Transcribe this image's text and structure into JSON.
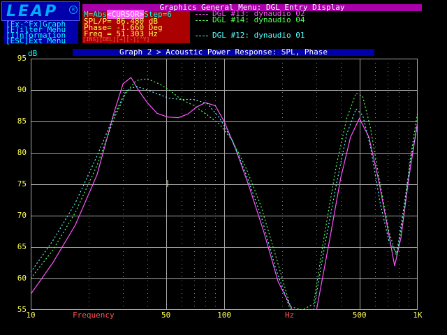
{
  "logo": {
    "text": "LEAP",
    "reg": "R"
  },
  "menu": {
    "title": "Graphics General Menu: DGL Entry Display"
  },
  "keys": [
    "[Fx-^Fx]Graph",
    "[F]ilter Menu",
    "[I]nformation",
    "[ESC]Ext Menu"
  ],
  "readout": {
    "mode": "M=Abs",
    "cursor": "<CURSOR>",
    "step": "Step=6",
    "spl": "SPL/P=   86.480 dB",
    "phase": "Phase=   -1.660 Deg",
    "freq": "Freq =   51.303 Hz",
    "kbd": "[INS][DEL][+][-][^Y]"
  },
  "legend": [
    {
      "label": "DGL #13: dynaudio 02",
      "color": "#ff55ff"
    },
    {
      "label": "DGL #14: dynaudio 04",
      "color": "#55ff55"
    },
    {
      "label": "DGL #12: dynaudio 01",
      "color": "#55ffff"
    }
  ],
  "graph": {
    "title": "Graph 2 > Acoustic Power Response: SPL, Phase",
    "y_unit": "dB",
    "x_axis_label": "Frequency",
    "x_unit_label": "Hz"
  },
  "chart_data": {
    "type": "line",
    "xscale": "log",
    "xlim": [
      10,
      1000
    ],
    "ylim": [
      55,
      95
    ],
    "y_ticks": [
      95,
      90,
      85,
      80,
      75,
      70,
      65,
      60,
      55
    ],
    "x_tick_labels": [
      {
        "value": 10,
        "label": "10"
      },
      {
        "value": 50,
        "label": "50"
      },
      {
        "value": 100,
        "label": "100"
      },
      {
        "value": 500,
        "label": "500"
      },
      {
        "value": 1000,
        "label": "1K"
      }
    ],
    "series": [
      {
        "color": "#ff55ff",
        "dash": "none",
        "x": [
          10,
          13,
          17,
          22,
          27,
          30,
          33,
          36,
          40,
          45,
          51,
          58,
          65,
          72,
          80,
          90,
          100,
          115,
          135,
          160,
          190,
          225,
          260,
          300,
          350,
          400,
          450,
          500,
          560,
          630,
          700,
          760,
          820,
          900,
          1000
        ],
        "y": [
          57.5,
          62.5,
          68.5,
          76.5,
          86.5,
          91.0,
          92.0,
          90.0,
          88.0,
          86.3,
          85.7,
          85.6,
          86.2,
          87.3,
          88.0,
          87.5,
          85.0,
          80.5,
          74.5,
          67.5,
          59.5,
          51.0,
          48.0,
          54.0,
          66.0,
          76.0,
          82.5,
          85.5,
          82.5,
          75.5,
          68.0,
          62.0,
          66.5,
          76.0,
          85.0
        ]
      },
      {
        "color": "#55ff55",
        "dash": "2,3",
        "x": [
          10,
          13,
          17,
          22,
          27,
          31,
          35,
          40,
          46,
          52,
          60,
          70,
          82,
          95,
          110,
          130,
          155,
          185,
          220,
          255,
          290,
          330,
          380,
          430,
          480,
          520,
          570,
          640,
          710,
          780,
          850,
          920,
          1000
        ],
        "y": [
          60.0,
          64.5,
          70.5,
          78.0,
          85.5,
          89.5,
          91.5,
          91.8,
          91.0,
          90.0,
          88.5,
          87.5,
          86.0,
          84.5,
          82.0,
          77.5,
          71.5,
          63.5,
          55.5,
          50.5,
          56.0,
          67.0,
          78.0,
          85.5,
          89.5,
          89.0,
          84.0,
          75.0,
          67.5,
          63.5,
          70.5,
          79.5,
          86.5
        ]
      },
      {
        "color": "#55ffff",
        "dash": "2,3",
        "x": [
          10,
          13,
          17,
          22,
          27,
          31,
          35,
          40,
          46,
          52,
          60,
          70,
          82,
          95,
          110,
          130,
          155,
          185,
          220,
          255,
          290,
          330,
          380,
          430,
          480,
          520,
          570,
          640,
          710,
          780,
          850,
          920,
          1000
        ],
        "y": [
          61.0,
          66.0,
          72.0,
          79.5,
          86.0,
          89.8,
          90.6,
          90.0,
          89.3,
          88.7,
          88.5,
          88.5,
          87.8,
          85.5,
          82.0,
          76.5,
          70.0,
          61.5,
          53.0,
          49.5,
          55.0,
          65.0,
          75.0,
          83.0,
          87.0,
          86.0,
          81.0,
          72.0,
          66.0,
          64.0,
          71.5,
          79.0,
          84.5
        ]
      }
    ]
  }
}
